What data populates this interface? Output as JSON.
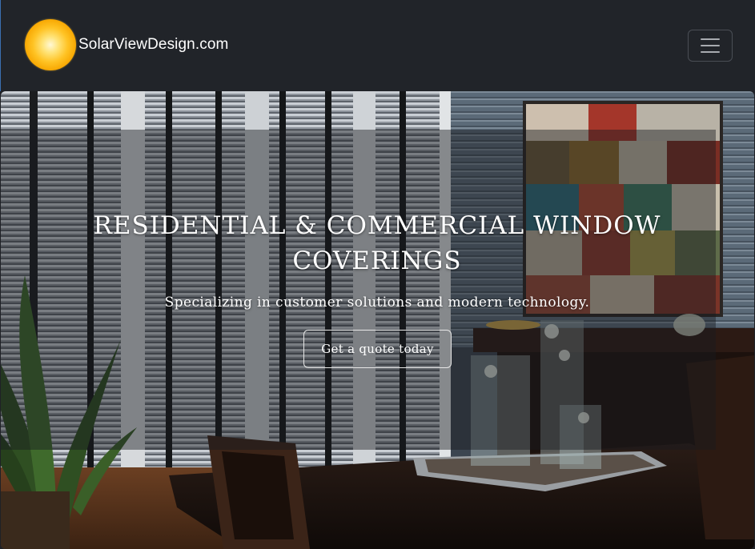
{
  "navbar": {
    "brand_name": "SolarViewDesign.com",
    "logo_icon": "sun-logo-icon",
    "toggler_icon": "hamburger-menu-icon"
  },
  "hero": {
    "title": "RESIDENTIAL & COMMERCIAL WINDOW COVERINGS",
    "subtitle": "Specializing in customer solutions and modern technology.",
    "cta_label": "Get a quote today",
    "background_image": "dining-room-with-window-blinds-photo"
  },
  "colors": {
    "navbar_bg": "#212429",
    "logo_sun": "#ffc324",
    "text": "#ffffff"
  }
}
